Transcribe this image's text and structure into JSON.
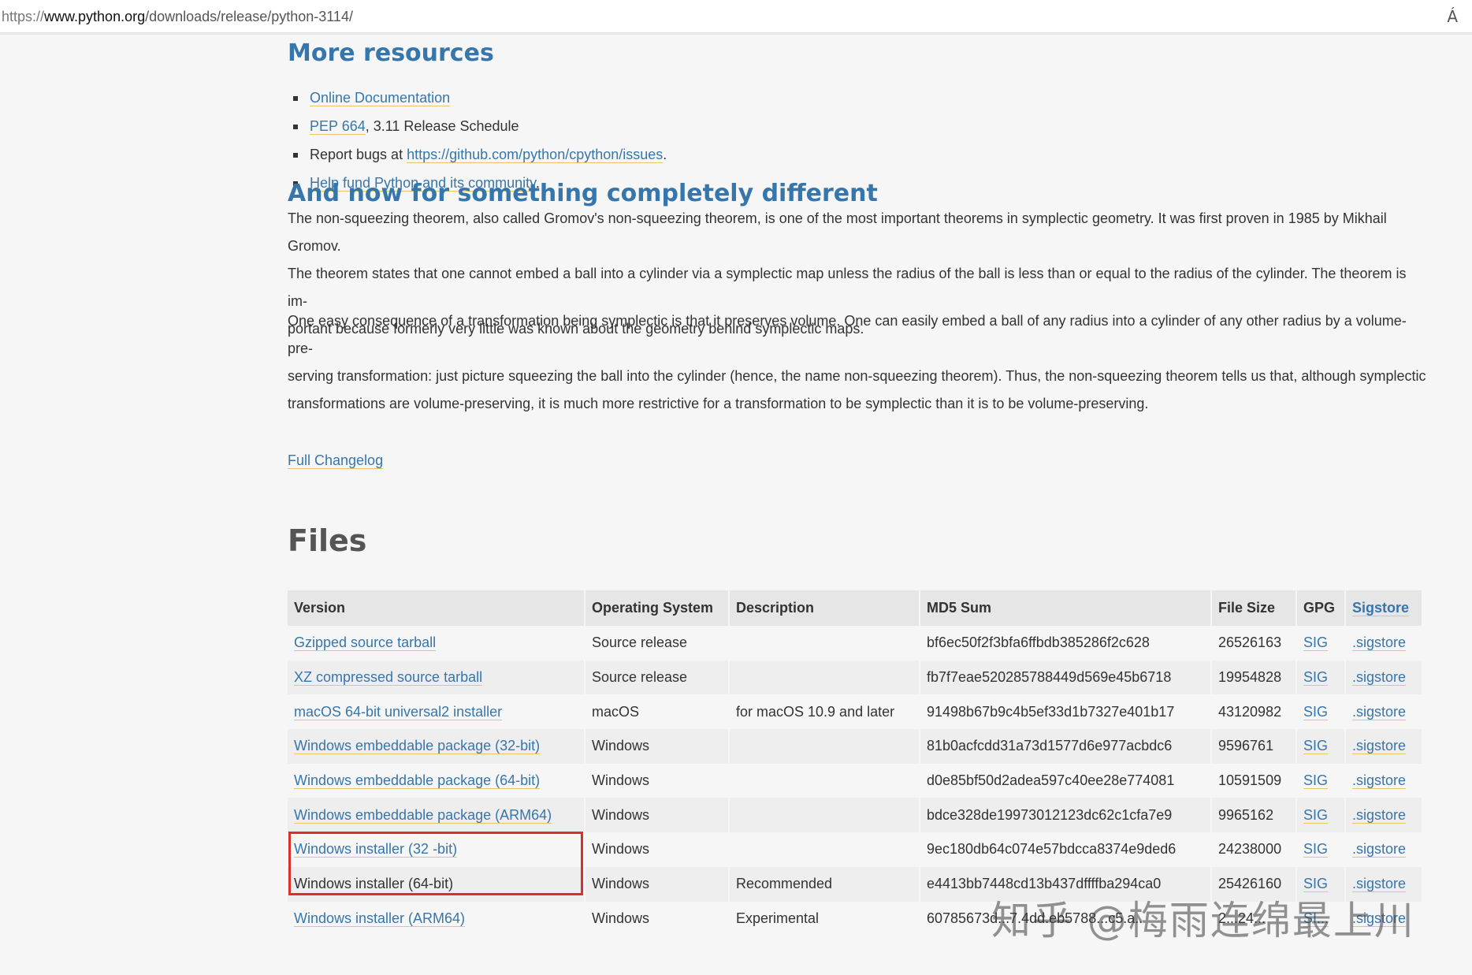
{
  "browser": {
    "url_protocol": "https://",
    "url_domain": "www.python.org",
    "url_path": "/downloads/release/python-3114/",
    "reader_label": "Á"
  },
  "more_resources": {
    "heading": "More resources",
    "items": [
      {
        "link": "Online Documentation",
        "text": ""
      },
      {
        "link": "PEP 664",
        "text": ", 3.11 Release Schedule"
      },
      {
        "prefix": "Report bugs at ",
        "link": "https://github.com/python/cpython/issues",
        "text": "."
      },
      {
        "link": "Help fund Python and its community",
        "text": "."
      }
    ]
  },
  "different": {
    "heading": "And now for something completely different",
    "paragraph1_lines": [
      "The non-squeezing theorem, also called Gromov's non-squeezing theorem, is one of the most important theorems in symplectic geometry. It was first proven in 1985 by Mikhail Gromov.",
      "The theorem states that one cannot embed a ball into a cylinder via a symplectic map unless the radius of the ball is less than or equal to the radius of the cylinder. The theorem is im-",
      "portant because formerly very little was known about the geometry behind symplectic maps."
    ],
    "paragraph2_lines": [
      "One easy consequence of a transformation being symplectic is that it preserves volume. One can easily embed a ball of any radius into a cylinder of any other radius by a volume-pre-",
      "serving transformation: just picture squeezing the ball into the cylinder (hence, the name non-squeezing theorem). Thus, the non-squeezing theorem tells us that, although symplectic",
      "transformations are volume-preserving, it is much more restrictive for a transformation to be symplectic than it is to be volume-preserving."
    ],
    "changelog": "Full Changelog"
  },
  "files": {
    "heading": "Files",
    "columns": [
      "Version",
      "Operating System",
      "Description",
      "MD5 Sum",
      "File Size",
      "GPG",
      "Sigstore"
    ],
    "rows": [
      {
        "version": "Gzipped source tarball",
        "os": "Source release",
        "desc": "",
        "md5": "bf6ec50f2f3bfa6ffbdb385286f2c628",
        "size": "26526163",
        "gpg": "SIG",
        "sigstore": ".sigstore",
        "linked": true
      },
      {
        "version": "XZ compressed source tarball",
        "os": "Source release",
        "desc": "",
        "md5": "fb7f7eae520285788449d569e45b6718",
        "size": "19954828",
        "gpg": "SIG",
        "sigstore": ".sigstore",
        "linked": true
      },
      {
        "version": "macOS 64-bit universal2 installer",
        "os": "macOS",
        "desc": "for macOS 10.9 and later",
        "md5": "91498b67b9c4b5ef33d1b7327e401b17",
        "size": "43120982",
        "gpg": "SIG",
        "sigstore": ".sigstore",
        "linked": true
      },
      {
        "version": "Windows embeddable package (32-bit)",
        "os": "Windows",
        "desc": "",
        "md5": "81b0acfcdd31a73d1577d6e977acbdc6",
        "size": "9596761",
        "gpg": "SIG",
        "sigstore": ".sigstore",
        "linked": true
      },
      {
        "version": "Windows embeddable package (64-bit)",
        "os": "Windows",
        "desc": "",
        "md5": "d0e85bf50d2adea597c40ee28e774081",
        "size": "10591509",
        "gpg": "SIG",
        "sigstore": ".sigstore",
        "linked": true
      },
      {
        "version": "Windows embeddable package (ARM64)",
        "os": "Windows",
        "desc": "",
        "md5": "bdce328de19973012123dc62c1cfa7e9",
        "size": "9965162",
        "gpg": "SIG",
        "sigstore": ".sigstore",
        "linked": true
      },
      {
        "version": "Windows installer (32 -bit)",
        "os": "Windows",
        "desc": "",
        "md5": "9ec180db64c074e57bdcca8374e9ded6",
        "size": "24238000",
        "gpg": "SIG",
        "sigstore": ".sigstore",
        "linked": true
      },
      {
        "version": "Windows installer (64-bit)",
        "os": "Windows",
        "desc": "Recommended",
        "md5": "e4413bb7448cd13b437dffffba294ca0",
        "size": "25426160",
        "gpg": "SIG",
        "sigstore": ".sigstore",
        "linked": false
      },
      {
        "version": "Windows installer (ARM64)",
        "os": "Windows",
        "desc": "Experimental",
        "md5": "60785673d...7.4dd.eb5788...c5.a..",
        "size": "2...24...",
        "gpg": "SI...",
        "sigstore": ".sigstore",
        "linked": true
      }
    ]
  },
  "watermark": "知乎 @梅雨连绵最上川",
  "colors": {
    "link": "#3776ab",
    "heading": "#3776ab",
    "highlight_border": "#d9302c"
  }
}
